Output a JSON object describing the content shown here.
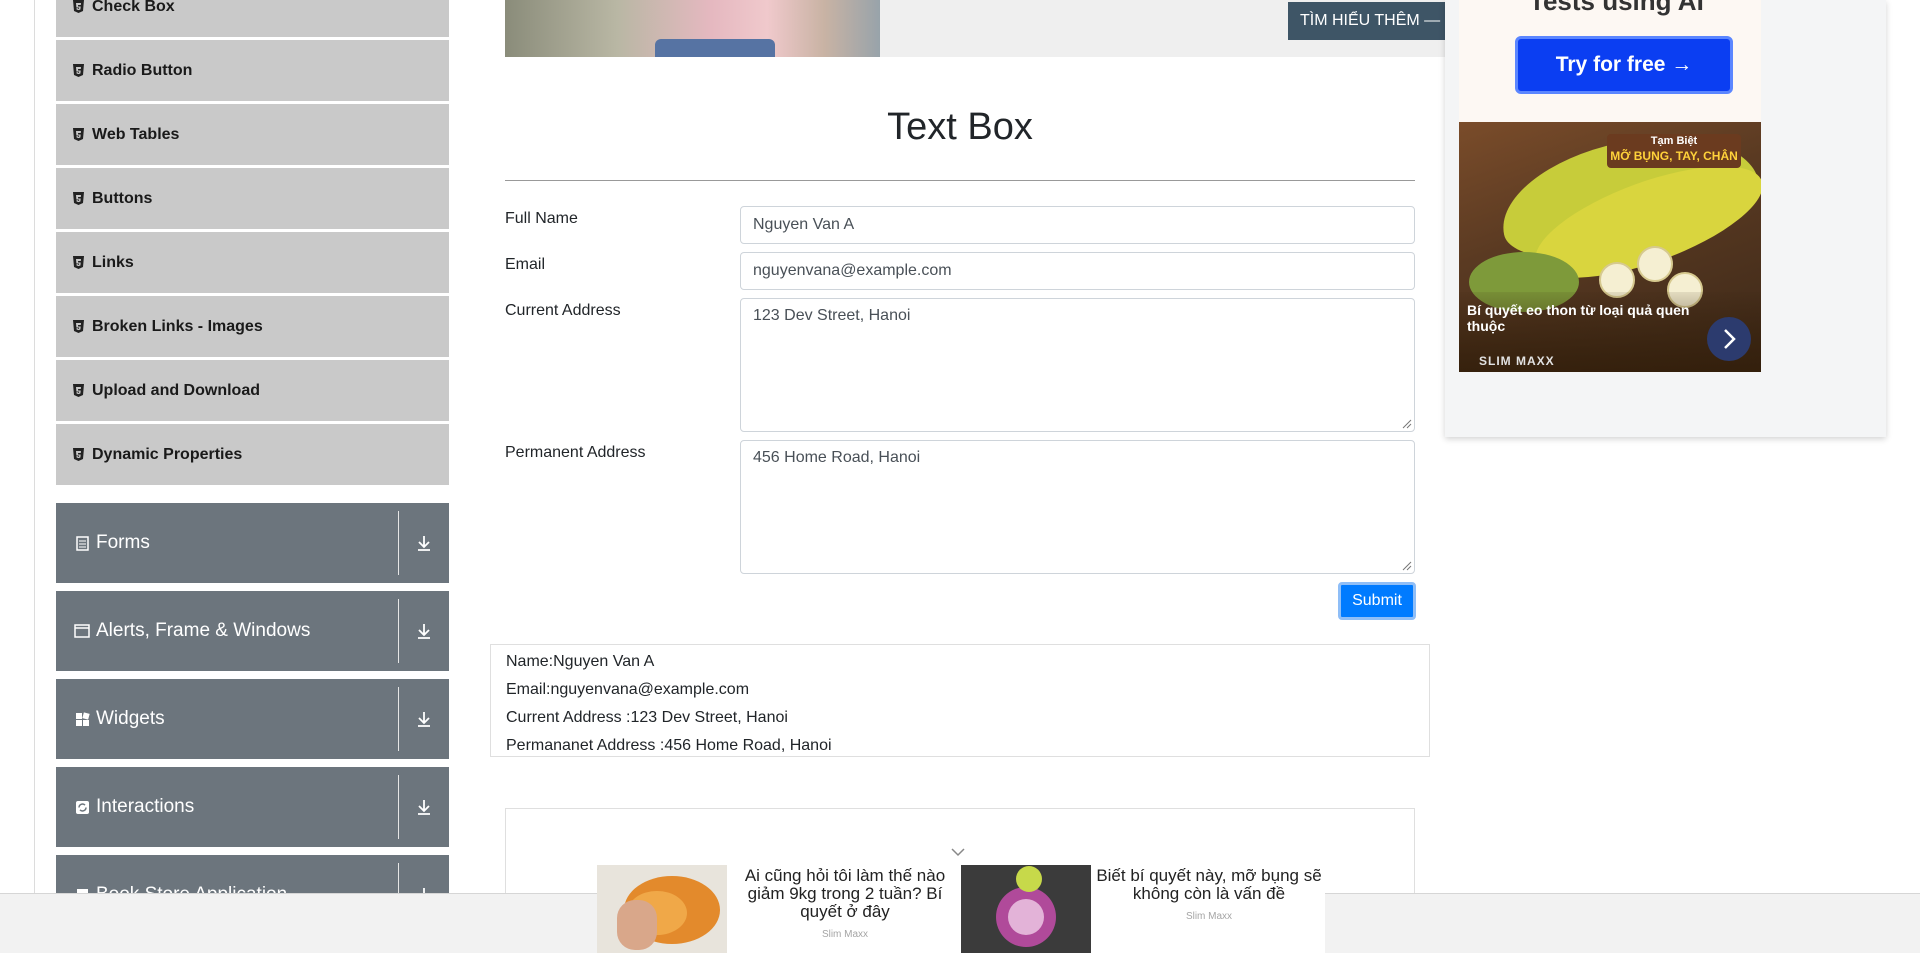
{
  "sidebar": {
    "sub_items": [
      {
        "label": "Check Box"
      },
      {
        "label": "Radio Button"
      },
      {
        "label": "Web Tables"
      },
      {
        "label": "Buttons"
      },
      {
        "label": "Links"
      },
      {
        "label": "Broken Links - Images"
      },
      {
        "label": "Upload and Download"
      },
      {
        "label": "Dynamic Properties"
      }
    ],
    "groups": [
      {
        "label": "Forms",
        "icon": "document-icon"
      },
      {
        "label": "Alerts, Frame & Windows",
        "icon": "window-icon"
      },
      {
        "label": "Widgets",
        "icon": "grid-icon"
      },
      {
        "label": "Interactions",
        "icon": "refresh-icon"
      },
      {
        "label": "Book Store Application",
        "icon": "book-icon"
      }
    ]
  },
  "banner": {
    "button_label": "TÌM HIỂU THÊM —"
  },
  "right_ad": {
    "heading_cut": "Tests using AI",
    "try_button": "Try for free →",
    "tag_line1": "Tạm Biệt",
    "tag_line2": "MỠ BỤNG, TAY, CHÂN",
    "text": "Bí quyết eo thon từ loại quả quen thuộc",
    "brand": "SLIM MAXX"
  },
  "form": {
    "title": "Text Box",
    "full_name_label": "Full Name",
    "full_name_value": "Nguyen Van A",
    "email_label": "Email",
    "email_value": "nguyenvana@example.com",
    "current_address_label": "Current Address",
    "current_address_value": "123 Dev Street, Hanoi",
    "permanent_address_label": "Permanent Address",
    "permanent_address_value": "456 Home Road, Hanoi",
    "submit_label": "Submit"
  },
  "output": {
    "name": "Name:Nguyen Van A",
    "email": "Email:nguyenvana@example.com",
    "current": "Current Address :123 Dev Street, Hanoi",
    "permanent": "Permananet Address :456 Home Road, Hanoi"
  },
  "bottom_ads": [
    {
      "text": "Ai cũng hỏi tôi làm thế nào giảm 9kg trong 2 tuần? Bí quyết ở đây",
      "source": "Slim Maxx"
    },
    {
      "text": "Biết bí quyết này, mỡ bụng sẽ không còn là vấn đề",
      "source": "Slim Maxx"
    }
  ],
  "colors": {
    "sidebar_group": "#6c757d",
    "sidebar_sub": "#c9c9c9",
    "submit": "#007bff",
    "try_button": "#0b3ef2"
  }
}
